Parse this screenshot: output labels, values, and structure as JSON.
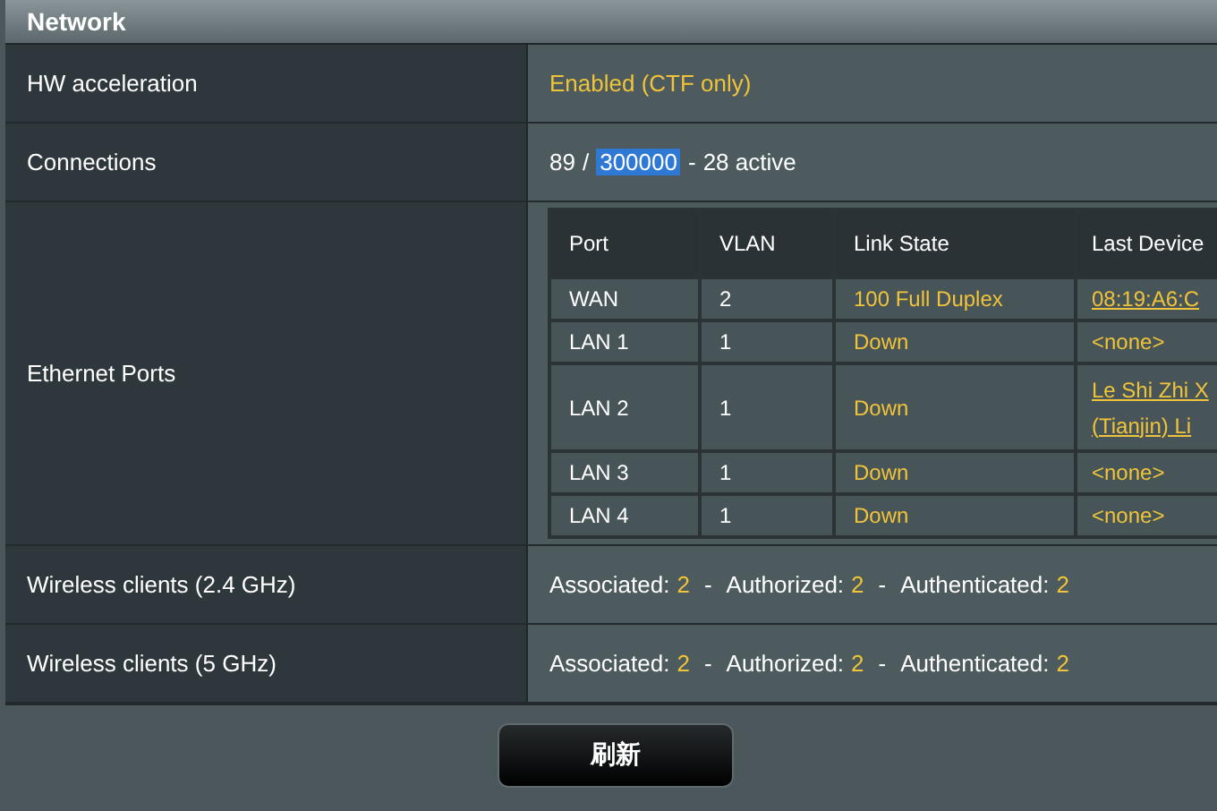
{
  "section_title": "Network",
  "rows": [
    {
      "kind": "text",
      "label": "HW acceleration",
      "value": "Enabled (CTF only)"
    },
    {
      "kind": "connections",
      "label": "Connections",
      "parts": [
        {
          "text": "89",
          "highlighted": false
        },
        {
          "text": "/",
          "highlighted": false
        },
        {
          "text": "300000",
          "highlighted": true
        },
        {
          "text": "-",
          "highlighted": false
        },
        {
          "text": "28 active",
          "highlighted": false
        }
      ]
    },
    {
      "kind": "ports",
      "label": "Ethernet Ports",
      "columns": [
        "Port",
        "VLAN",
        "Link State",
        "Last Device"
      ],
      "ports": [
        {
          "port": "WAN",
          "vlan": "2",
          "link_state": "100 Full Duplex",
          "last_device": [
            "08:19:A6:C"
          ],
          "kind": "link"
        },
        {
          "port": "LAN 1",
          "vlan": "1",
          "link_state": "Down",
          "last_device": [
            "<none>"
          ],
          "kind": "text"
        },
        {
          "port": "LAN 2",
          "vlan": "1",
          "link_state": "Down",
          "last_device": [
            "Le Shi Zhi X",
            "(Tianjin) Li"
          ],
          "kind": "link"
        },
        {
          "port": "LAN 3",
          "vlan": "1",
          "link_state": "Down",
          "last_device": [
            "<none>"
          ],
          "kind": "text"
        },
        {
          "port": "LAN 4",
          "vlan": "1",
          "link_state": "Down",
          "last_device": [
            "<none>"
          ],
          "kind": "text"
        }
      ]
    },
    {
      "kind": "stats",
      "label": "Wireless clients (2.4 GHz)",
      "separator": "-",
      "stats": [
        {
          "label": "Associated:",
          "value": "2"
        },
        {
          "label": "Authorized:",
          "value": "2"
        },
        {
          "label": "Authenticated:",
          "value": "2"
        }
      ]
    },
    {
      "kind": "stats",
      "label": "Wireless clients (5 GHz)",
      "separator": "-",
      "stats": [
        {
          "label": "Associated:",
          "value": "2"
        },
        {
          "label": "Authorized:",
          "value": "2"
        },
        {
          "label": "Authenticated:",
          "value": "2"
        }
      ]
    }
  ],
  "refresh_button": "刷新"
}
